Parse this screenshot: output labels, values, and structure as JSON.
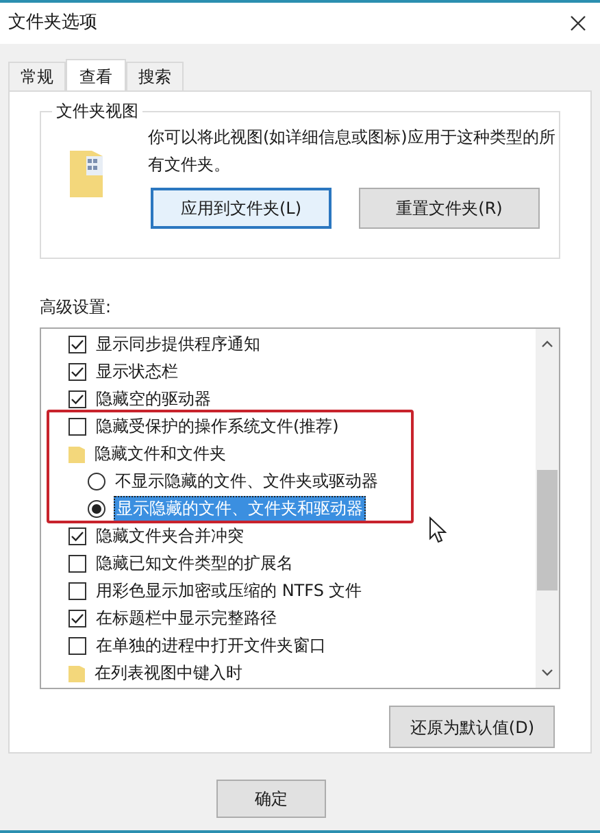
{
  "window": {
    "title": "文件夹选项"
  },
  "tabs": [
    {
      "label": "常规",
      "selected": false
    },
    {
      "label": "查看",
      "selected": true
    },
    {
      "label": "搜索",
      "selected": false
    }
  ],
  "folder_views": {
    "title": "文件夹视图",
    "description": "你可以将此视图(如详细信息或图标)应用于这种类型的所有文件夹。",
    "buttons": [
      {
        "label": "应用到文件夹(L)",
        "focused": true
      },
      {
        "label": "重置文件夹(R)",
        "focused": false
      }
    ]
  },
  "advanced": {
    "label": "高级设置:",
    "items": [
      {
        "kind": "checkbox",
        "label": "显示同步提供程序通知",
        "checked": true
      },
      {
        "kind": "checkbox",
        "label": "显示状态栏",
        "checked": true
      },
      {
        "kind": "checkbox",
        "label": "隐藏空的驱动器",
        "checked": true
      },
      {
        "kind": "checkbox",
        "label": "隐藏受保护的操作系统文件(推荐)",
        "checked": false
      },
      {
        "kind": "group",
        "label": "隐藏文件和文件夹",
        "children": [
          {
            "kind": "radio",
            "label": "不显示隐藏的文件、文件夹或驱动器",
            "selected": false
          },
          {
            "kind": "radio",
            "label": "显示隐藏的文件、文件夹和驱动器",
            "selected": true
          }
        ]
      },
      {
        "kind": "checkbox",
        "label": "隐藏文件夹合并冲突",
        "checked": true
      },
      {
        "kind": "checkbox",
        "label": "隐藏已知文件类型的扩展名",
        "checked": false
      },
      {
        "kind": "checkbox",
        "label": "用彩色显示加密或压缩的 NTFS 文件",
        "checked": false
      },
      {
        "kind": "checkbox",
        "label": "在标题栏中显示完整路径",
        "checked": true
      },
      {
        "kind": "checkbox",
        "label": "在单独的进程中打开文件夹窗口",
        "checked": false
      },
      {
        "kind": "group",
        "label": "在列表视图中键入时"
      }
    ],
    "restore_button": "还原为默认值(D)"
  },
  "footer_buttons": [
    "确定"
  ]
}
